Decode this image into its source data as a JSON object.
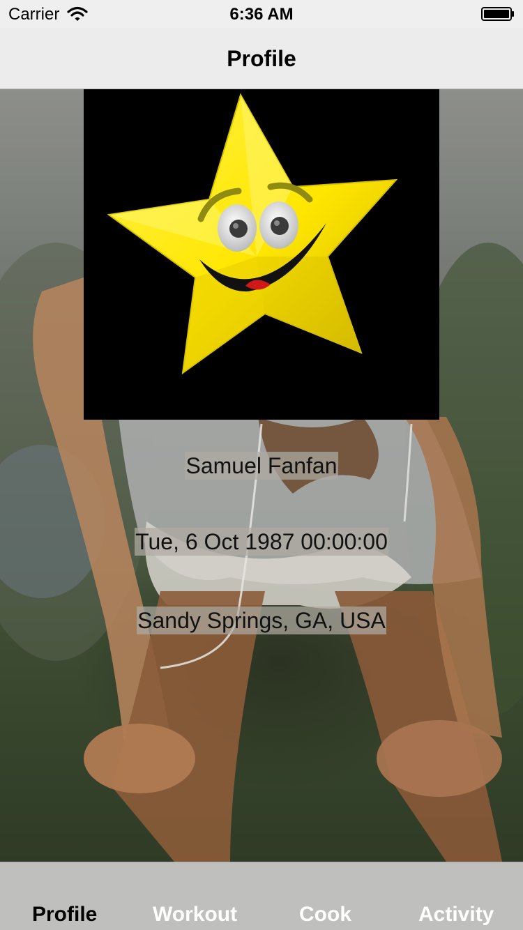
{
  "status_bar": {
    "carrier": "Carrier",
    "time": "6:36 AM",
    "wifi_icon": "wifi-icon",
    "battery_icon": "battery-full-icon"
  },
  "nav": {
    "title": "Profile"
  },
  "profile": {
    "avatar_icon": "smiling-star-image",
    "name": "Samuel Fanfan",
    "birthdate": "Tue, 6 Oct 1987 00:00:00",
    "location": "Sandy Springs, GA, USA"
  },
  "tabs": [
    {
      "label": "Profile",
      "selected": true
    },
    {
      "label": "Workout",
      "selected": false
    },
    {
      "label": "Cook",
      "selected": false
    },
    {
      "label": "Activity",
      "selected": false
    }
  ],
  "colors": {
    "selected_tab": "#000000",
    "unselected_tab": "#ffffff",
    "star_yellow": "#ffe81a",
    "label_background": "#afaaa2"
  }
}
